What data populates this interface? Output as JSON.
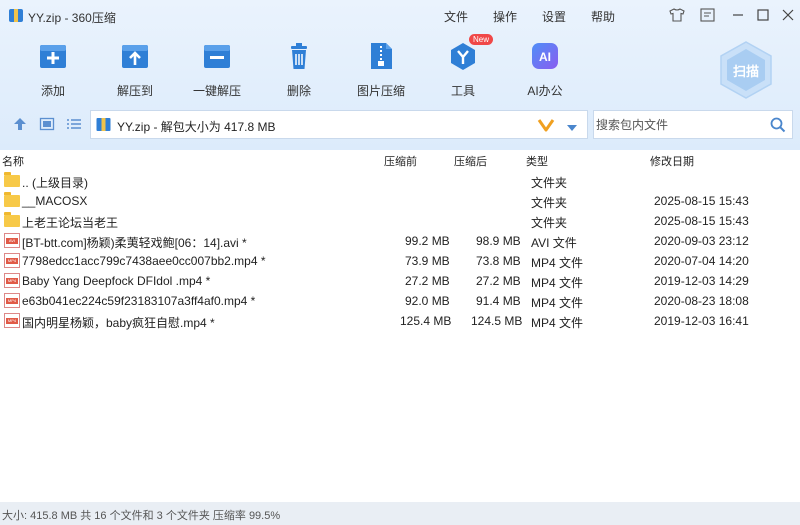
{
  "window": {
    "title": "YY.zip - 360压缩"
  },
  "menu": {
    "file": "文件",
    "operate": "操作",
    "settings": "设置",
    "help": "帮助"
  },
  "toolbar": {
    "add": "添加",
    "extract_to": "解压到",
    "one_click_extract": "一键解压",
    "delete": "删除",
    "image_compress": "图片压缩",
    "tools": "工具",
    "tools_badge": "New",
    "ai_office": "AI办公",
    "scan": "扫描"
  },
  "path": {
    "text": "YY.zip - 解包大小为 417.8 MB"
  },
  "search": {
    "placeholder": "搜索包内文件"
  },
  "columns": {
    "name": "名称",
    "compressed_before": "压缩前",
    "compressed_after": "压缩后",
    "type": "类型",
    "modified": "修改日期"
  },
  "files": [
    {
      "name": ".. (上级目录)",
      "before": "",
      "after": "",
      "type": "文件夹",
      "date": "",
      "icon": "folder-icon"
    },
    {
      "name": "__MACOSX",
      "before": "",
      "after": "",
      "type": "文件夹",
      "date": "2025-08-15 15:43",
      "icon": "folder-icon"
    },
    {
      "name": "上老王论坛当老王",
      "before": "",
      "after": "",
      "type": "文件夹",
      "date": "2025-08-15 15:43",
      "icon": "folder-icon"
    },
    {
      "name": "[BT-btt.com]杨颖)柔荑轻戏鲍[06：14].avi *",
      "before": "99.2 MB",
      "after": "98.9 MB",
      "type": "AVI 文件",
      "date": "2020-09-03 23:12",
      "icon": "avi-file-icon"
    },
    {
      "name": "7798edcc1acc799c7438aee0cc007bb2.mp4 *",
      "before": "73.9 MB",
      "after": "73.8 MB",
      "type": "MP4 文件",
      "date": "2020-07-04 14:20",
      "icon": "mp4-file-icon"
    },
    {
      "name": "Baby Yang Deepfock  DFIdol .mp4 *",
      "before": "27.2 MB",
      "after": "27.2 MB",
      "type": "MP4 文件",
      "date": "2019-12-03 14:29",
      "icon": "mp4-file-icon"
    },
    {
      "name": "e63b041ec224c59f23183107a3ff4af0.mp4 *",
      "before": "92.0 MB",
      "after": "91.4 MB",
      "type": "MP4 文件",
      "date": "2020-08-23 18:08",
      "icon": "mp4-file-icon"
    },
    {
      "name": "国内明星杨颖，baby疯狂自慰.mp4 *",
      "before": "125.4 MB",
      "after": "124.5 MB",
      "type": "MP4 文件",
      "date": "2019-12-03 16:41",
      "icon": "mp4-file-icon"
    }
  ],
  "status": {
    "text": "大小: 415.8 MB 共 16 个文件和 3 个文件夹 压缩率 99.5%"
  },
  "colors": {
    "accent": "#2f7fd6",
    "top_bg": "#e3effc",
    "folder": "#f7c948",
    "badge": "#f04848",
    "path_arrow": "#f0a020"
  }
}
